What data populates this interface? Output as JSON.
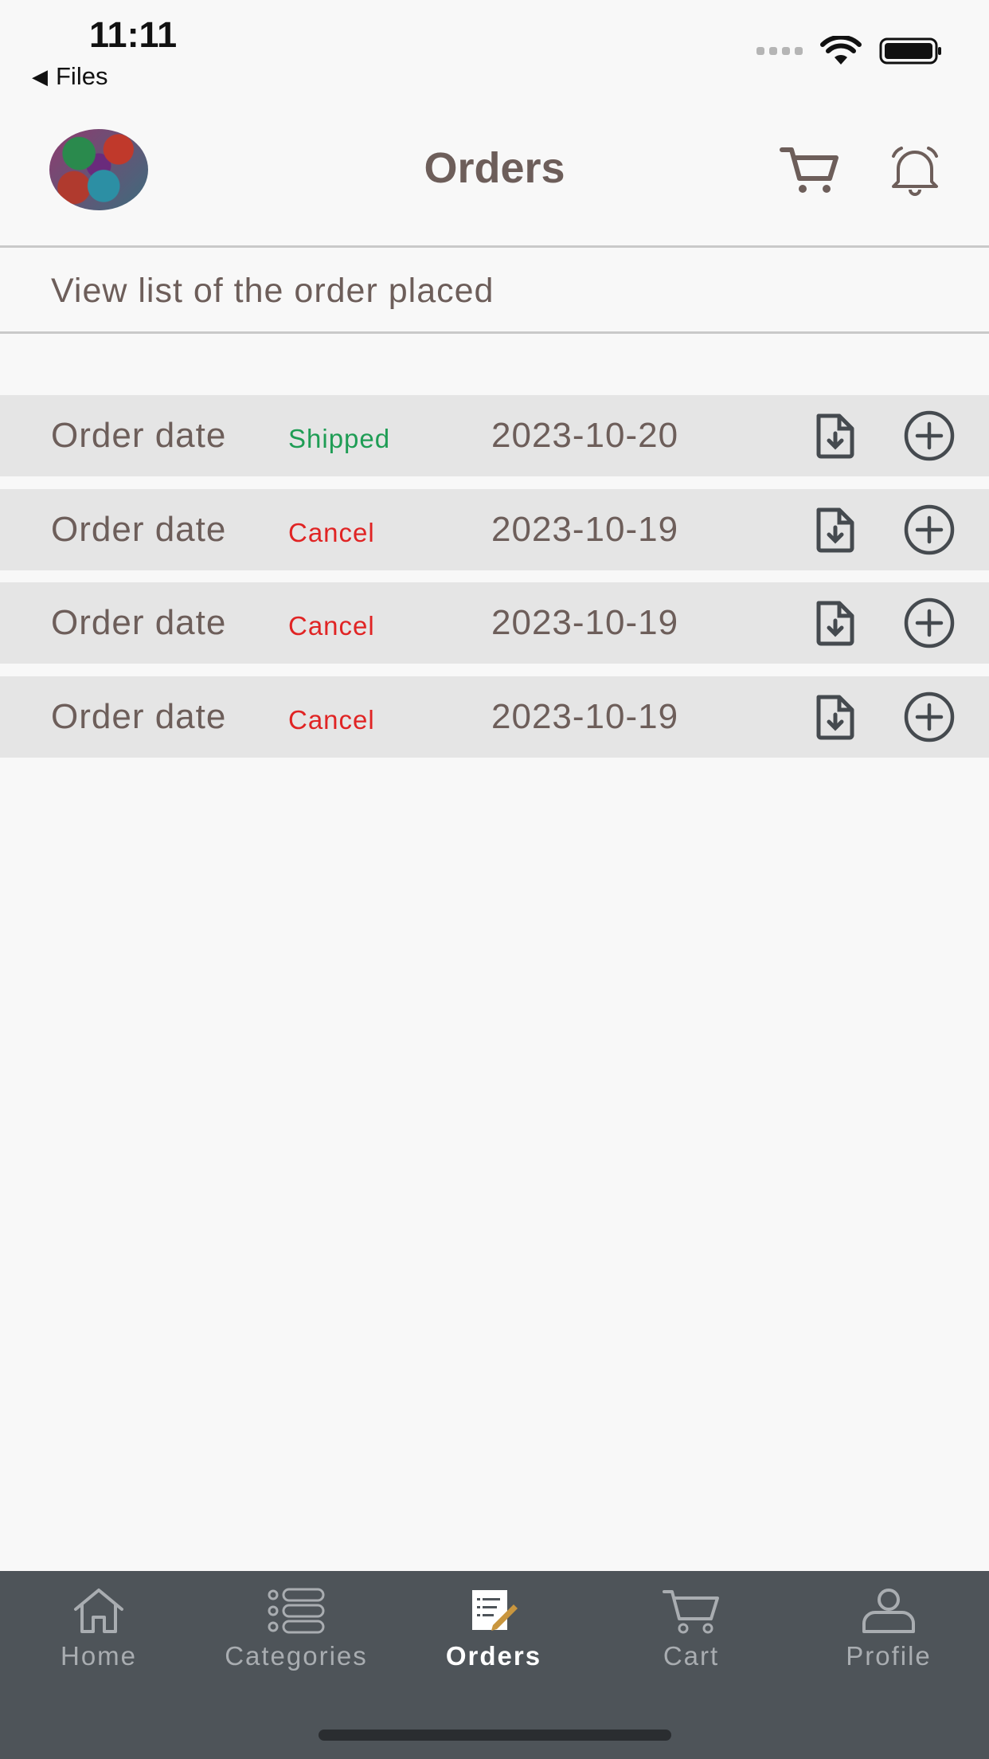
{
  "status_bar": {
    "time": "11:11",
    "back_label": "Files"
  },
  "header": {
    "title": "Orders",
    "avatar_icon": "avatar",
    "cart_icon": "cart-icon",
    "bell_icon": "bell-icon"
  },
  "subtitle": "View list of the order placed",
  "orders": [
    {
      "label": "Order date",
      "status": "Shipped",
      "status_color": "#1f9d55",
      "date": "2023-10-20"
    },
    {
      "label": "Order date",
      "status": "Cancel",
      "status_color": "#e02424",
      "date": "2023-10-19"
    },
    {
      "label": "Order date",
      "status": "Cancel",
      "status_color": "#e02424",
      "date": "2023-10-19"
    },
    {
      "label": "Order date",
      "status": "Cancel",
      "status_color": "#e02424",
      "date": "2023-10-19"
    }
  ],
  "tabs": [
    {
      "label": "Home",
      "icon": "home-icon",
      "active": false
    },
    {
      "label": "Categories",
      "icon": "list-icon",
      "active": false
    },
    {
      "label": "Orders",
      "icon": "orders-icon",
      "active": true
    },
    {
      "label": "Cart",
      "icon": "cart-icon",
      "active": false
    },
    {
      "label": "Profile",
      "icon": "profile-icon",
      "active": false
    }
  ],
  "colors": {
    "background": "#f8f8f8",
    "row_background": "#e5e5e5",
    "text": "#6d5e5a",
    "tabbar": "#4e5459",
    "shipped": "#1f9d55",
    "cancel": "#e02424"
  }
}
